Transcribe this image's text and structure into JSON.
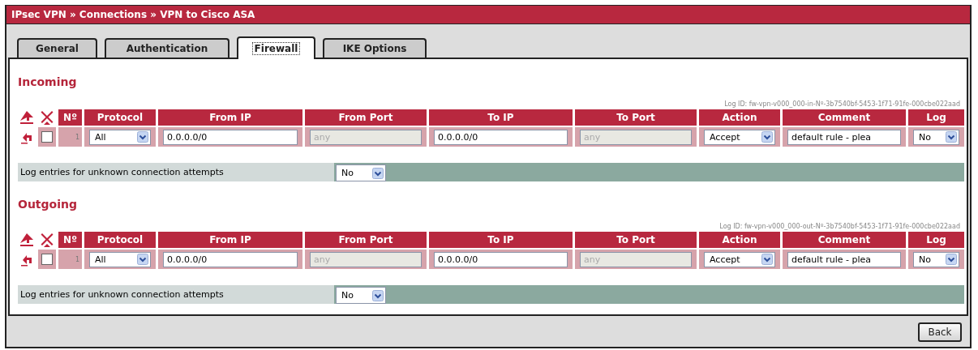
{
  "breadcrumb": "IPsec VPN » Connections » VPN to Cisco ASA",
  "tabs": [
    {
      "label": "General",
      "selected": false
    },
    {
      "label": "Authentication",
      "selected": false
    },
    {
      "label": "Firewall",
      "selected": true
    },
    {
      "label": "IKE Options",
      "selected": false
    }
  ],
  "sections": [
    {
      "title": "Incoming",
      "log_id": "Log ID: fw-vpn-v000_000-in-Nº-3b7540bf-5453-1f71-91fe-000cbe022aad",
      "columns": [
        "Nº",
        "Protocol",
        "From IP",
        "From Port",
        "To IP",
        "To Port",
        "Action",
        "Comment",
        "Log"
      ],
      "rows": [
        {
          "checked": false,
          "cells": [
            {
              "kind": "number",
              "value": "1"
            },
            {
              "kind": "select",
              "value": "All"
            },
            {
              "kind": "input",
              "value": "0.0.0.0/0",
              "disabled": false
            },
            {
              "kind": "input",
              "value": "any",
              "disabled": true
            },
            {
              "kind": "input",
              "value": "0.0.0.0/0",
              "disabled": false
            },
            {
              "kind": "input",
              "value": "any",
              "disabled": true
            },
            {
              "kind": "select",
              "value": "Accept"
            },
            {
              "kind": "input",
              "value": "default rule - plea",
              "disabled": false
            },
            {
              "kind": "select",
              "value": "No"
            }
          ]
        }
      ],
      "unknown_log": {
        "label": "Log entries for unknown connection attempts",
        "value": "No"
      }
    },
    {
      "title": "Outgoing",
      "log_id": "Log ID: fw-vpn-v000_000-out-Nº-3b7540bf-5453-1f71-91fe-000cbe022aad",
      "columns": [
        "Nº",
        "Protocol",
        "From IP",
        "From Port",
        "To IP",
        "To Port",
        "Action",
        "Comment",
        "Log"
      ],
      "rows": [
        {
          "checked": false,
          "cells": [
            {
              "kind": "number",
              "value": "1"
            },
            {
              "kind": "select",
              "value": "All"
            },
            {
              "kind": "input",
              "value": "0.0.0.0/0",
              "disabled": false
            },
            {
              "kind": "input",
              "value": "any",
              "disabled": true
            },
            {
              "kind": "input",
              "value": "0.0.0.0/0",
              "disabled": false
            },
            {
              "kind": "input",
              "value": "any",
              "disabled": true
            },
            {
              "kind": "select",
              "value": "Accept"
            },
            {
              "kind": "input",
              "value": "default rule - plea",
              "disabled": false
            },
            {
              "kind": "select",
              "value": "No"
            }
          ]
        }
      ],
      "unknown_log": {
        "label": "Log entries for unknown connection attempts",
        "value": "No"
      }
    }
  ],
  "buttons": [
    "Back"
  ]
}
